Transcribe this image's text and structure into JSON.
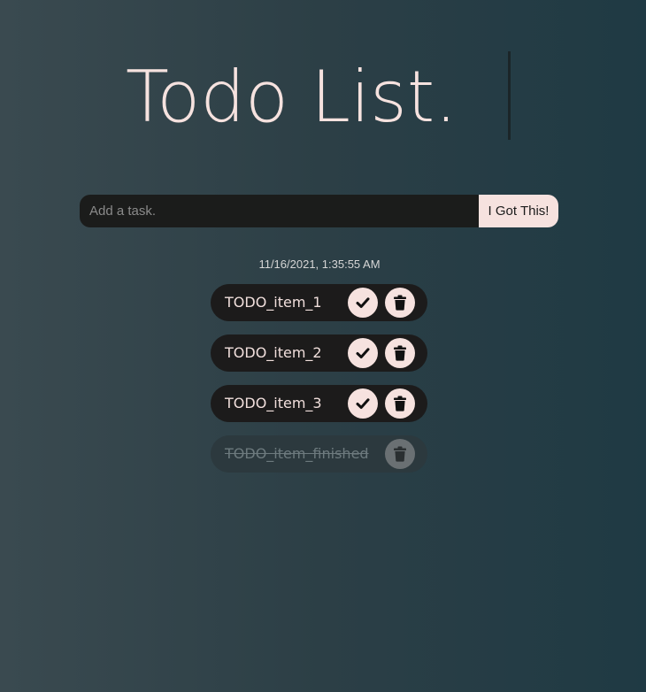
{
  "header": {
    "title": "Todo List."
  },
  "form": {
    "placeholder": "Add a task.",
    "value": "",
    "submit_label": "I Got This!"
  },
  "timestamp": "11/16/2021, 1:35:55 AM",
  "todos": [
    {
      "label": "TODO_item_1",
      "completed": false
    },
    {
      "label": "TODO_item_2",
      "completed": false
    },
    {
      "label": "TODO_item_3",
      "completed": false
    },
    {
      "label": "TODO_item_finished",
      "completed": true
    }
  ],
  "icons": {
    "complete": "checkmark-icon",
    "delete": "trash-icon"
  },
  "colors": {
    "accent": "#f6e2df",
    "item_background": "#1c1b1b",
    "input_background": "#1b1c1b",
    "completed_item_background": "#2c393e",
    "completed_text": "#6d7a7e",
    "background_start": "#3a4a50",
    "background_end": "#1f3a44"
  }
}
